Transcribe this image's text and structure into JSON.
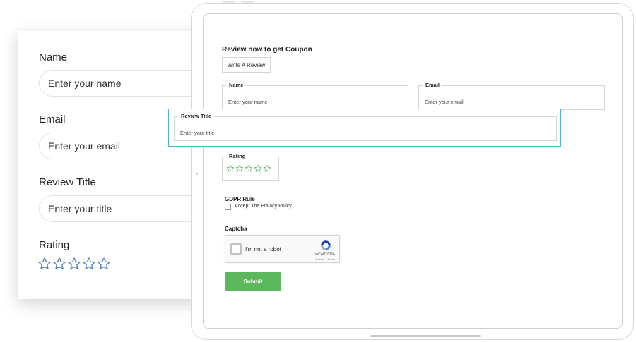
{
  "left_card": {
    "name_label": "Name",
    "name_placeholder": "Enter your name",
    "email_label": "Email",
    "email_placeholder": "Enter your email",
    "title_label": "Review Title",
    "title_placeholder": "Enter your title",
    "rating_label": "Rating",
    "rating_value": 0,
    "rating_max": 5
  },
  "form": {
    "heading": "Review now to get Coupon",
    "write_review_button": "Write A Review",
    "name_legend": "Name",
    "name_placeholder": "Enter your name",
    "email_legend": "Email",
    "email_placeholder": "Enter your email",
    "title_legend": "Review Title",
    "title_placeholder": "Enter your title",
    "rating_legend": "Rating",
    "rating_value": 0,
    "rating_max": 5,
    "gdpr_label": "GDPR Rule",
    "privacy_checkbox_label": "Accept The Privacy Policy",
    "privacy_checked": false,
    "captcha_label": "Captcha",
    "recaptcha_text": "I'm not a robot",
    "recaptcha_brand": "reCAPTCHA",
    "recaptcha_terms": "Privacy - Terms",
    "submit_button": "Submit"
  },
  "colors": {
    "left_star": "#4a7fbd",
    "form_star": "#5cb85c",
    "submit": "#5cb85c",
    "highlight_border": "#4bb8cf"
  },
  "icons": {
    "star": "star-outline-icon",
    "recaptcha": "recaptcha-logo-icon"
  }
}
